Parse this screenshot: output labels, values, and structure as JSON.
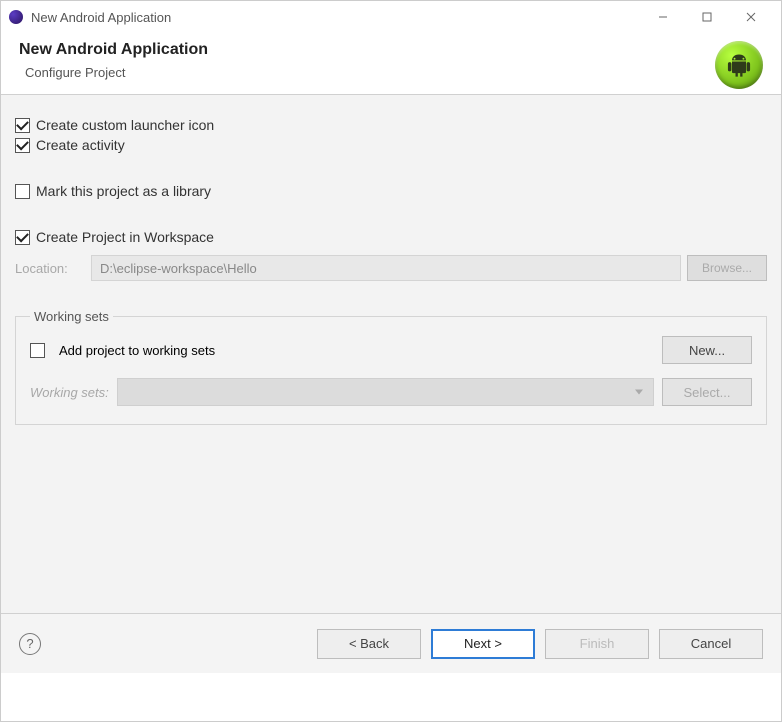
{
  "titlebar": {
    "title": "New Android Application"
  },
  "header": {
    "heading": "New Android Application",
    "subtitle": "Configure Project"
  },
  "options": {
    "custom_launcher": {
      "label": "Create custom launcher icon",
      "checked": true
    },
    "create_activity": {
      "label": "Create activity",
      "checked": true
    },
    "mark_library": {
      "label": "Mark this project as a library",
      "checked": false
    },
    "in_workspace": {
      "label": "Create Project in Workspace",
      "checked": true
    }
  },
  "location": {
    "label": "Location:",
    "value": "D:\\eclipse-workspace\\Hello",
    "browse": "Browse..."
  },
  "working_sets": {
    "legend": "Working sets",
    "add_label": "Add project to working sets",
    "add_checked": false,
    "new_btn": "New...",
    "field_label": "Working sets:",
    "select_btn": "Select..."
  },
  "footer": {
    "back": "< Back",
    "next": "Next >",
    "finish": "Finish",
    "cancel": "Cancel"
  }
}
